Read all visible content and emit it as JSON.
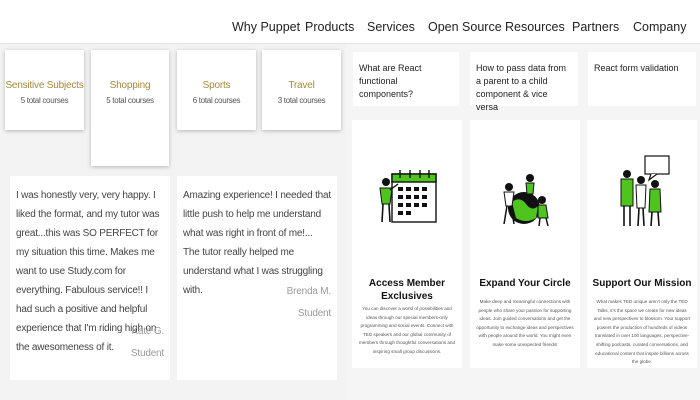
{
  "nav": {
    "items": [
      "Why Puppet",
      "Products",
      "Services",
      "Open Source",
      "Resources",
      "Partners",
      "Company"
    ]
  },
  "categories": [
    {
      "name": "Sensitive Subjects",
      "count": "5 total courses"
    },
    {
      "name": "Shopping",
      "count": "5 total courses"
    },
    {
      "name": "Sports",
      "count": "6 total courses"
    },
    {
      "name": "Travel",
      "count": "3 total courses"
    }
  ],
  "reviews": [
    {
      "quote": "I was honestly very, very happy. I liked the format, and my tutor was great...this was SO PERFECT for my situation this time. Makes me want to use Study.com for everything. Fabulous service!! I had such a positive and helpful experience that I'm riding high on the awesomeness of it.",
      "name": "Kate G.",
      "role": "Student"
    },
    {
      "quote": "Amazing experience! I needed that little push to help me understand what was right in front of me!... The tutor really helped me understand what I was struggling with.",
      "name": "Brenda M.",
      "role": "Student"
    }
  ],
  "questions": [
    "What are React functional components?",
    "How to pass data from a parent to a child component & vice versa",
    "React form validation"
  ],
  "features": [
    {
      "icon": "calendar-person-icon",
      "title": "Access Member Exclusives",
      "desc": "You can discover a world of possibilities and ideas through our special members-only programming and social events. Connect with TED speakers and our global community of members through thoughtful conversations and inspiring small group discussions."
    },
    {
      "icon": "globe-people-icon",
      "title": "Expand Your Circle",
      "desc": "Make deep and meaningful connections with people who share your passion for supporting ideas. Join guided conversations and get the opportunity to exchange ideas and perspectives with people around the world. You might even make some unexpected friends!"
    },
    {
      "icon": "group-speech-icon",
      "title": "Support Our Mission",
      "desc": "What makes TED unique aren't only the TED Talks, it's the space we create for new ideas and new perspectives to blossom. Your support powers the production of hundreds of videos translated in over 100 languages, perspective-shifting podcasts, curated conversations, and educational content that inspire billions across the globe."
    }
  ],
  "colors": {
    "accent_gold": "#a5883a",
    "illustration_green": "#4fc41f"
  }
}
